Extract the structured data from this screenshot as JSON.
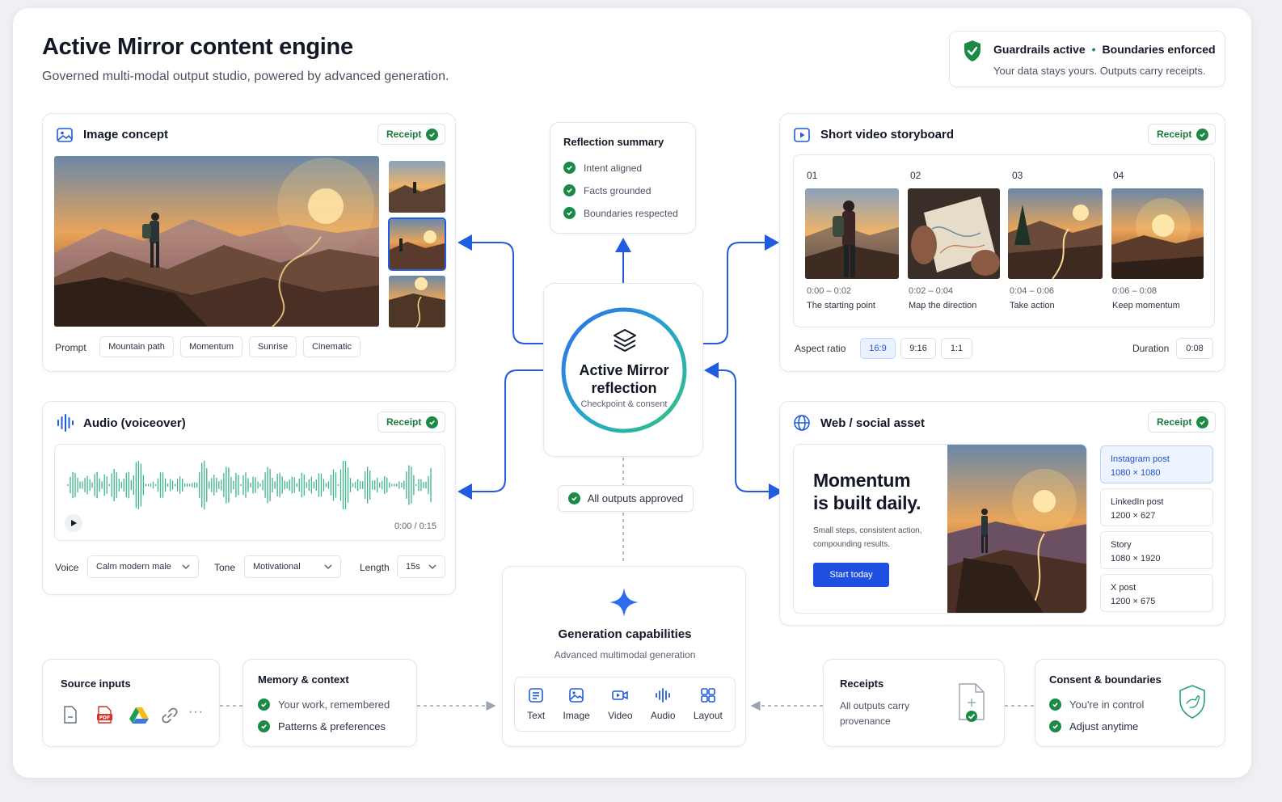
{
  "header": {
    "title": "Active Mirror content engine",
    "subtitle": "Governed multi-modal output studio, powered by advanced generation.",
    "guardrail": "Guardrails active",
    "separator": "•",
    "boundaries": "Boundaries enforced",
    "guardrail_sub": "Your data stays yours. Outputs carry receipts."
  },
  "receipt_label": "Receipt",
  "image_concept": {
    "title": "Image concept",
    "prompt_label": "Prompt",
    "tags": [
      "Mountain path",
      "Momentum",
      "Sunrise",
      "Cinematic"
    ]
  },
  "audio": {
    "title": "Audio (voiceover)",
    "time": "0:00 / 0:15",
    "voice_label": "Voice",
    "voice_value": "Calm modern male",
    "tone_label": "Tone",
    "tone_value": "Motivational",
    "length_label": "Length",
    "length_value": "15s"
  },
  "reflection_summary": {
    "title": "Reflection summary",
    "items": [
      "Intent aligned",
      "Facts grounded",
      "Boundaries respected"
    ]
  },
  "center": {
    "title_line1": "Active Mirror",
    "title_line2": "reflection",
    "subtitle": "Checkpoint & consent",
    "approved": "All outputs approved"
  },
  "video": {
    "title": "Short video storyboard",
    "frames": [
      {
        "num": "01",
        "time": "0:00 – 0:02",
        "caption": "The starting point"
      },
      {
        "num": "02",
        "time": "0:02 – 0:04",
        "caption": "Map the direction"
      },
      {
        "num": "03",
        "time": "0:04 – 0:06",
        "caption": "Take action"
      },
      {
        "num": "04",
        "time": "0:06 – 0:08",
        "caption": "Keep momentum"
      }
    ],
    "aspect_label": "Aspect ratio",
    "aspects": [
      "16:9",
      "9:16",
      "1:1"
    ],
    "duration_label": "Duration",
    "duration_value": "0:08"
  },
  "web": {
    "title": "Web / social asset",
    "headline_line1": "Momentum",
    "headline_line2": "is built daily.",
    "body_line1": "Small steps, consistent action,",
    "body_line2": "compounding results.",
    "cta": "Start today",
    "sizes": [
      {
        "name": "Instagram post",
        "dims": "1080 × 1080"
      },
      {
        "name": "LinkedIn post",
        "dims": "1200 × 627"
      },
      {
        "name": "Story",
        "dims": "1080 × 1920"
      },
      {
        "name": "X post",
        "dims": "1200 × 675"
      }
    ]
  },
  "generation": {
    "title": "Generation capabilities",
    "subtitle": "Advanced multimodal generation",
    "tools": [
      "Text",
      "Image",
      "Video",
      "Audio",
      "Layout"
    ]
  },
  "source_inputs": {
    "title": "Source inputs",
    "more": "···"
  },
  "memory": {
    "title": "Memory & context",
    "items": [
      "Your work, remembered",
      "Patterns & preferences"
    ]
  },
  "receipts": {
    "title": "Receipts",
    "line1": "All outputs carry",
    "line2": "provenance"
  },
  "consent": {
    "title": "Consent & boundaries",
    "items": [
      "You're in control",
      "Adjust anytime"
    ]
  },
  "colors": {
    "accent_blue": "#1f5ce0",
    "approve_green": "#1a8a44",
    "wave_green": "#3db58a"
  }
}
